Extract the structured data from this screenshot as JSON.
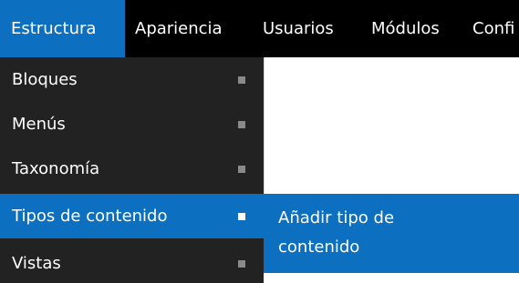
{
  "topbar": {
    "items": [
      {
        "label": "Estructura"
      },
      {
        "label": "Apariencia"
      },
      {
        "label": "Usuarios"
      },
      {
        "label": "Módulos"
      },
      {
        "label": "Confi"
      }
    ]
  },
  "dropdown": {
    "items": [
      {
        "label": "Bloques",
        "bullet_icon": "square-bullet-icon"
      },
      {
        "label": "Menús",
        "bullet_icon": "square-bullet-icon"
      },
      {
        "label": "Taxonomía",
        "bullet_icon": "square-bullet-icon"
      },
      {
        "label": "Tipos de contenido",
        "bullet_icon": "square-bullet-icon"
      },
      {
        "label": "Vistas",
        "bullet_icon": "square-bullet-icon"
      }
    ]
  },
  "submenu": {
    "items": [
      {
        "label": "Añadir tipo de contenido"
      }
    ]
  },
  "colors": {
    "topbar_bg": "#000000",
    "dropdown_bg": "#222222",
    "active_bg": "#0c6fc0",
    "text": "#ffffff",
    "bullet": "#8a8a8a"
  }
}
